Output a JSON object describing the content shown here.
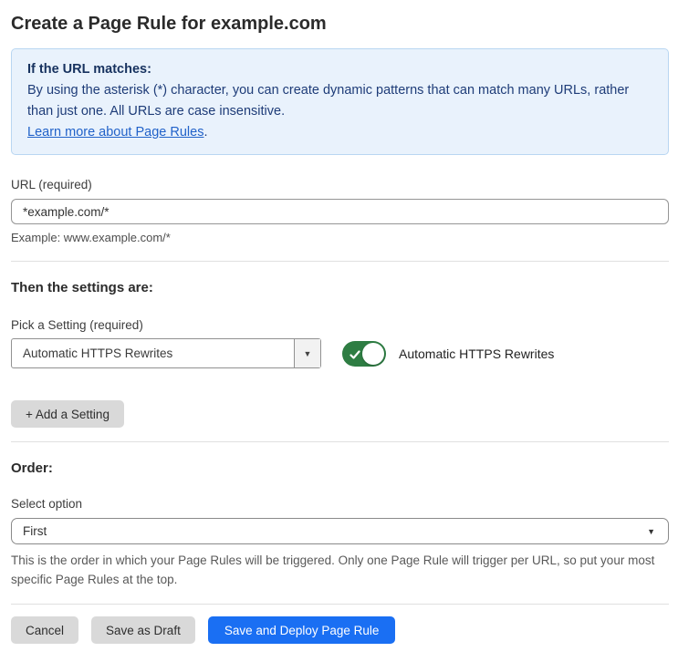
{
  "page": {
    "title": "Create a Page Rule for example.com"
  },
  "info_box": {
    "heading": "If the URL matches:",
    "body": "By using the asterisk (*) character, you can create dynamic patterns that can match many URLs, rather than just one. All URLs are case insensitive.",
    "link_label": "Learn more about Page Rules",
    "link_suffix": "."
  },
  "url_field": {
    "label": "URL (required)",
    "value": "*example.com/*",
    "helper": "Example: www.example.com/*"
  },
  "settings_section": {
    "heading": "Then the settings are:",
    "picker_label": "Pick a Setting (required)",
    "picker_value": "Automatic HTTPS Rewrites",
    "dropdown_arrow": "▼",
    "toggle_state": "on",
    "toggle_label": "Automatic HTTPS Rewrites",
    "add_setting_button": "+ Add a Setting"
  },
  "order_section": {
    "heading": "Order:",
    "select_label": "Select option",
    "select_value": "First",
    "select_chevron": "▼",
    "helper": "This is the order in which your Page Rules will be triggered. Only one Page Rule will trigger per URL, so put your most specific Page Rules at the top."
  },
  "footer": {
    "cancel_label": "Cancel",
    "save_draft_label": "Save as Draft",
    "save_deploy_label": "Save and Deploy Page Rule"
  },
  "colors": {
    "info_bg": "#e9f2fc",
    "info_border": "#b9d6f2",
    "info_text": "#1e3c78",
    "link": "#2162c9",
    "toggle_on": "#2e7d43",
    "primary_button": "#1a6ff3",
    "secondary_button": "#d9d9d9"
  }
}
